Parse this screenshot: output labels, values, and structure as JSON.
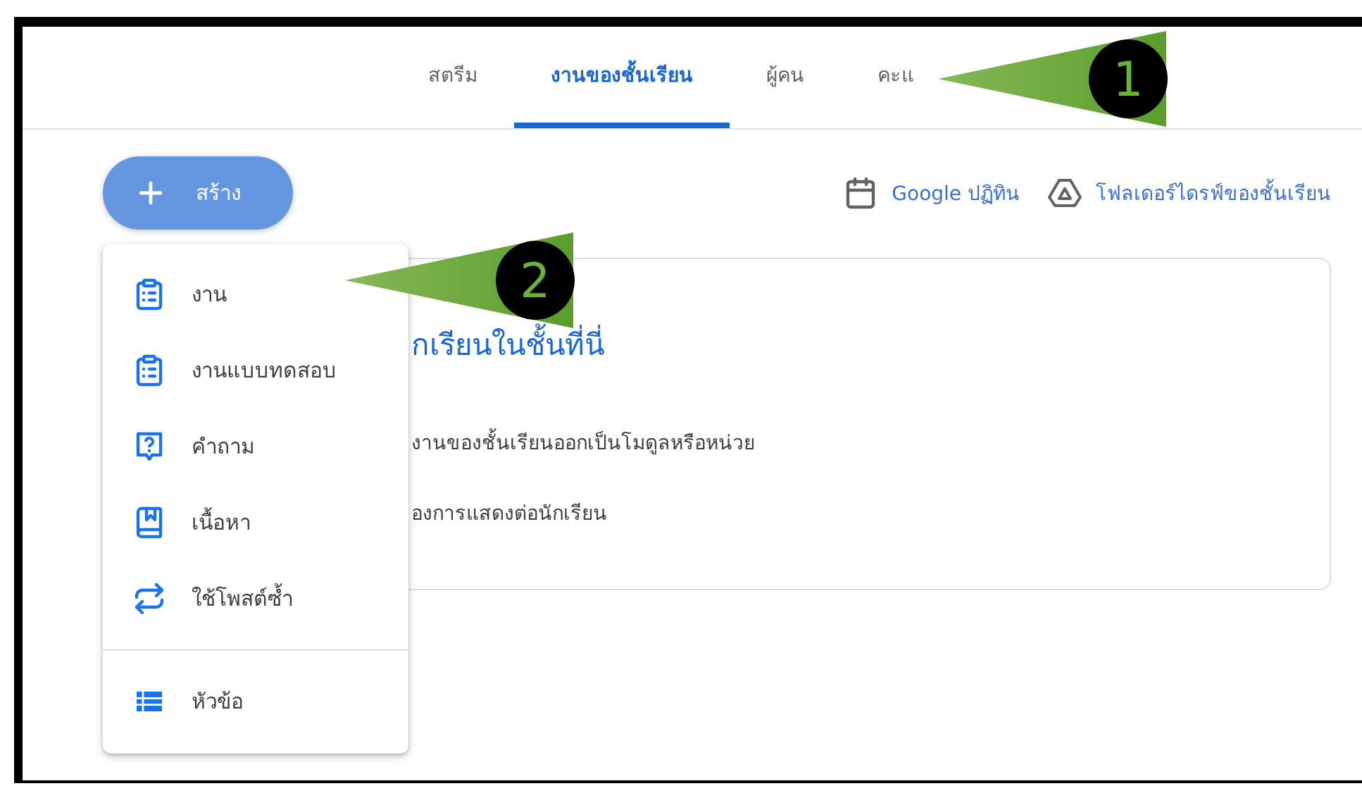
{
  "tabs": [
    {
      "label": "สตรีม",
      "selected": false
    },
    {
      "label": "งานของชั้นเรียน",
      "selected": true
    },
    {
      "label": "ผู้คน",
      "selected": false
    },
    {
      "label": "คะแ",
      "selected": false
    }
  ],
  "create_button": {
    "label": "สร้าง"
  },
  "links": [
    {
      "kind": "calendar",
      "label": "Google ปฏิทิน"
    },
    {
      "kind": "drive",
      "label": "โฟลเดอร์ไดรฟ์ของชั้นเรียน"
    }
  ],
  "create_menu": {
    "groups": [
      {
        "items": [
          {
            "kind": "assignment",
            "label": "งาน"
          },
          {
            "kind": "quiz",
            "label": "งานแบบทดสอบ"
          },
          {
            "kind": "question",
            "label": "คำถาม"
          },
          {
            "kind": "material",
            "label": "เนื้อหา"
          },
          {
            "kind": "reuse",
            "label": "ใช้โพสต์ซ้ำ"
          }
        ]
      },
      {
        "items": [
          {
            "kind": "topic",
            "label": "หัวข้อ"
          }
        ]
      }
    ]
  },
  "card": {
    "heading": "กเรียนในชั้นที่นี่",
    "lines": [
      "งานของชั้นเรียนออกเป็นโมดูลหรือหน่วย",
      "องการแสดงต่อนักเรียน"
    ]
  },
  "annotations": [
    {
      "label": "1"
    },
    {
      "label": "2"
    }
  ]
}
